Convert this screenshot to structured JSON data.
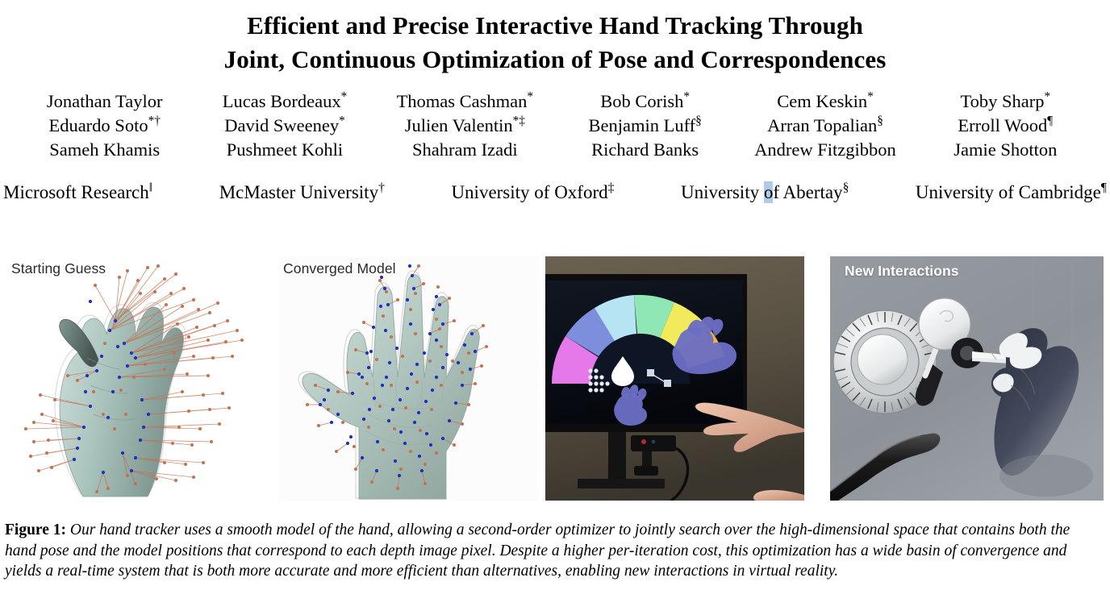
{
  "paper": {
    "title_lines": [
      "Efficient and Precise Interactive Hand Tracking Through",
      "Joint, Continuous Optimization of Pose and Correspondences"
    ],
    "authors": [
      [
        {
          "name": "Jonathan Taylor",
          "mark": ""
        },
        {
          "name": "Lucas Bordeaux",
          "mark": "*"
        },
        {
          "name": "Thomas Cashman",
          "mark": "*"
        },
        {
          "name": "Bob Corish",
          "mark": "*"
        },
        {
          "name": "Cem Keskin",
          "mark": "*"
        },
        {
          "name": "Toby Sharp",
          "mark": "*"
        }
      ],
      [
        {
          "name": "Eduardo Soto",
          "mark": "*†"
        },
        {
          "name": "David Sweeney",
          "mark": "*"
        },
        {
          "name": "Julien Valentin",
          "mark": "*‡"
        },
        {
          "name": "Benjamin Luff",
          "mark": "§"
        },
        {
          "name": "Arran Topalian",
          "mark": "§"
        },
        {
          "name": "Erroll Wood",
          "mark": "¶"
        }
      ],
      [
        {
          "name": "Sameh Khamis",
          "mark": ""
        },
        {
          "name": "Pushmeet Kohli",
          "mark": ""
        },
        {
          "name": "Shahram Izadi",
          "mark": ""
        },
        {
          "name": "Richard Banks",
          "mark": ""
        },
        {
          "name": "Andrew Fitzgibbon",
          "mark": ""
        },
        {
          "name": "Jamie Shotton",
          "mark": ""
        }
      ]
    ],
    "affiliations": [
      {
        "name": "Microsoft Research",
        "mark": "‖",
        "selected_char": ""
      },
      {
        "name": "McMaster University",
        "mark": "†",
        "selected_char": ""
      },
      {
        "name": "University of Oxford",
        "mark": "‡",
        "selected_char": ""
      },
      {
        "name": "University of Abertay",
        "mark": "§",
        "selected_char": "o",
        "selection_color": "#aecbe8"
      },
      {
        "name": "University of Cambridge",
        "mark": "¶",
        "selected_char": ""
      }
    ]
  },
  "figure": {
    "panels": [
      {
        "id": "starting-guess",
        "label": "Starting Guess",
        "label_color": "#2a2a2a",
        "background": "#ffffff",
        "description": "teal 3d hand model with long orange correspondence rays"
      },
      {
        "id": "converged-model",
        "label": "Converged Model",
        "label_color": "#2a2a2a",
        "background": "#fcfcfc",
        "description": "open palm teal hand with dense blue and orange correspondence points"
      },
      {
        "id": "display-photo",
        "label": "",
        "label_color": "",
        "background": "#0b0a08",
        "description": "photograph of monitor showing colour arc menu with purple virtual hands, depth camera below and real hand reaching in"
      },
      {
        "id": "new-interactions",
        "label": "New Interactions",
        "label_color": "#ffffff",
        "background": "#8e949a",
        "description": "grey virtual reality scene with safe dial, lever and dark virtual hand grasping a handle"
      }
    ]
  },
  "caption": {
    "label": "Figure 1:",
    "text": "Our hand tracker uses a smooth model of the hand, allowing a second-order optimizer to jointly search over the high-dimensional space that contains both the hand pose and the model positions that correspond to each depth image pixel. Despite a higher per-iteration cost, this optimization has a wide basin of convergence and yields a real-time system that is both more accurate and more efficient than alternatives, enabling new interactions in virtual reality."
  },
  "colors": {
    "hand_model": "#a9c4bc",
    "correspondence_point": "#c4714f",
    "model_point": "#1f2fc0",
    "vr_background": "#8e949a",
    "selection_highlight": "#aecbe8"
  }
}
